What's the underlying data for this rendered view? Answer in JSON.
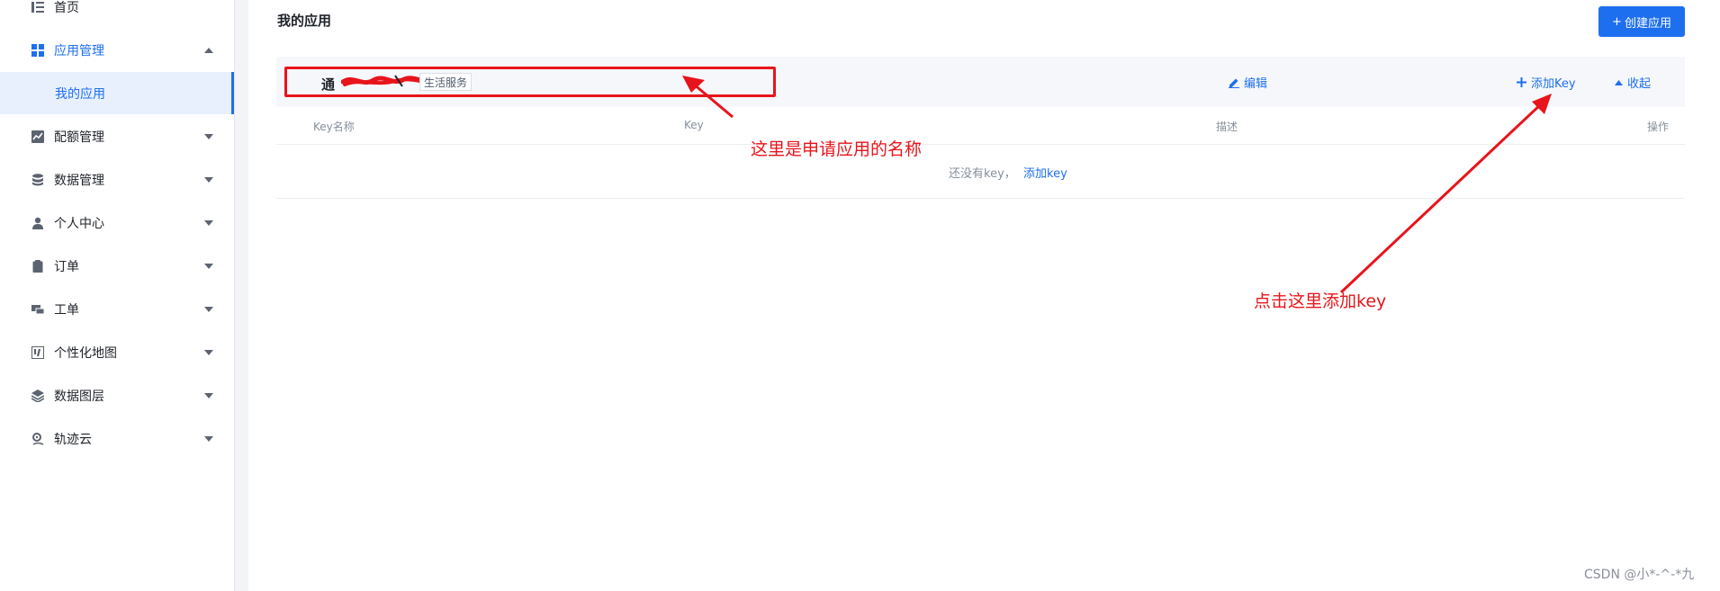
{
  "sidebar": {
    "items": [
      {
        "label": "首页",
        "icon": "list-icon"
      },
      {
        "label": "应用管理",
        "icon": "grid-icon"
      },
      {
        "label": "配额管理",
        "icon": "chart-icon"
      },
      {
        "label": "数据管理",
        "icon": "database-icon"
      },
      {
        "label": "个人中心",
        "icon": "user-icon"
      },
      {
        "label": "订单",
        "icon": "clipboard-icon"
      },
      {
        "label": "工单",
        "icon": "ticket-icon"
      },
      {
        "label": "个性化地图",
        "icon": "map-style-icon"
      },
      {
        "label": "数据图层",
        "icon": "layers-icon"
      },
      {
        "label": "轨迹云",
        "icon": "track-icon"
      }
    ],
    "active_sub": "我的应用"
  },
  "main": {
    "title": "我的应用",
    "create_button": "创建应用",
    "app": {
      "name": "通",
      "tag": "生活服务",
      "edit": "编辑",
      "add_key": "添加Key",
      "collapse": "收起"
    },
    "table": {
      "columns": [
        "Key名称",
        "Key",
        "描述",
        "操作"
      ],
      "empty_text": "还没有key，",
      "empty_link": "添加key"
    }
  },
  "annotations": {
    "app_name_note": "这里是申请应用的名称",
    "add_key_note": "点击这里添加key"
  },
  "watermark": "CSDN @小*-^-*九",
  "colors": {
    "accent": "#1e6fef",
    "annotation": "#e8141b"
  }
}
